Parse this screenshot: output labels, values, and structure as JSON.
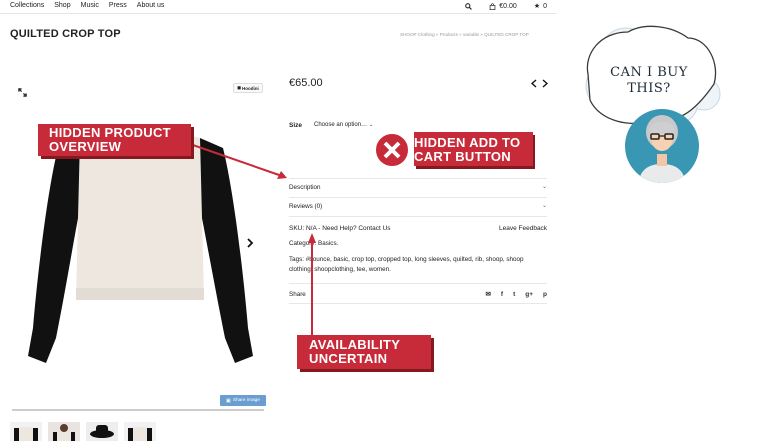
{
  "nav": {
    "links": [
      "Collections",
      "Shop",
      "Music",
      "Press",
      "About us"
    ],
    "cart_total": "€0.00",
    "wishlist_count": "0"
  },
  "page": {
    "title": "QUILTED CROP TOP",
    "breadcrumb": "SHOOP Clothing » Products » variable » QUILTED CROP TOP"
  },
  "gallery": {
    "brand_label": "Hoodini",
    "share_image_label": "Share image"
  },
  "product": {
    "price": "€65.00",
    "size_label": "Size",
    "size_select": "Choose an option…",
    "accordion": [
      "Description",
      "Reviews (0)"
    ],
    "sku_text": "SKU: N/A - Need Help? Contact Us",
    "feedback_label": "Leave Feedback",
    "categories_text": "Category: Basics.",
    "tags_text": "Tags: #bounce, basic, crop top, cropped top, long sleeves, quilted, rib, shoop, shoop clothing, shoopclothing, tee, women.",
    "share_label": "Share"
  },
  "callouts": {
    "overview_line1": "HIDDEN PRODUCT",
    "overview_line2": "OVERVIEW",
    "cart_line1": "HIDDEN ADD TO",
    "cart_line2": "CART BUTTON",
    "availability_line1": "AVAILABILITY",
    "availability_line2": "UNCERTAIN"
  },
  "bubble": {
    "line1": "CAN I BUY",
    "line2": "THIS?"
  },
  "colors": {
    "callout_red": "#c72a38",
    "avatar_teal": "#3a97b4",
    "share_button_blue": "#6b9ed0"
  }
}
